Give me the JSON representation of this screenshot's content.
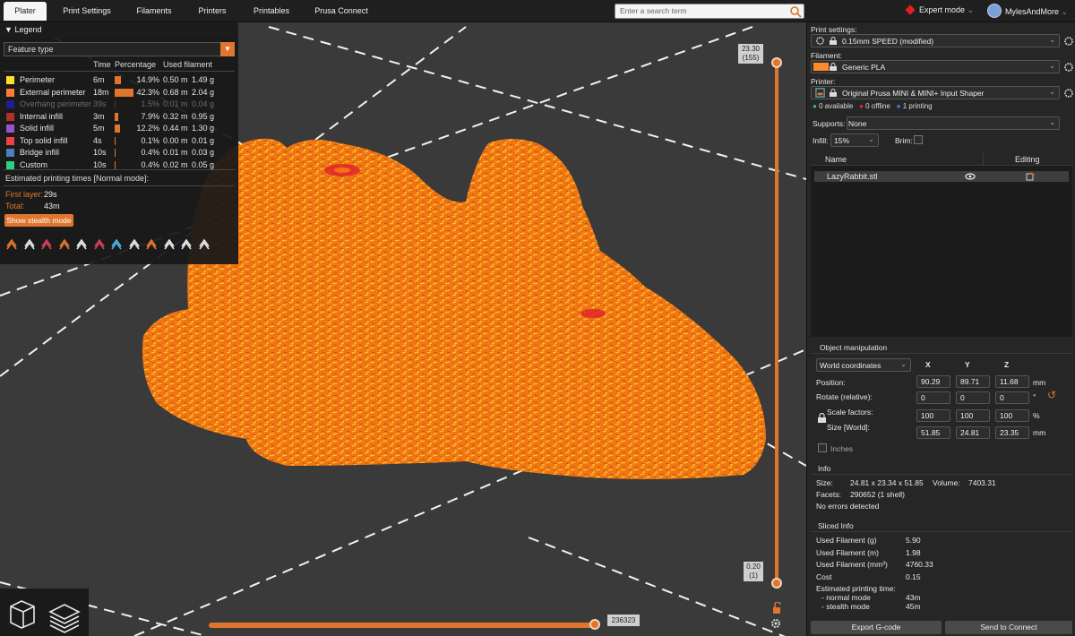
{
  "tabs": [
    "Plater",
    "Print Settings",
    "Filaments",
    "Printers",
    "Printables",
    "Prusa Connect"
  ],
  "search": {
    "placeholder": "Enter a search term"
  },
  "mode": "Expert mode",
  "user": "MylesAndMore",
  "legend": {
    "title": "Legend",
    "type": "Feature type",
    "col_time": "Time",
    "col_percentage": "Percentage",
    "col_used": "Used filament",
    "rows": [
      {
        "name": "Perimeter",
        "color": "#ffe12a",
        "time": "6m",
        "pct": "14.9%",
        "pct_value": 14.9,
        "m": "0.50 m",
        "g": "1.49 g",
        "dim": false
      },
      {
        "name": "External perimeter",
        "color": "#ff7d38",
        "time": "18m",
        "pct": "42.3%",
        "pct_value": 42.3,
        "m": "0.68 m",
        "g": "2.04 g",
        "dim": false
      },
      {
        "name": "Overhang perimeter",
        "color": "#1f1f8c",
        "time": "39s",
        "pct": "1.5%",
        "pct_value": 1.5,
        "m": "0.01 m",
        "g": "0.04 g",
        "dim": true
      },
      {
        "name": "Internal infill",
        "color": "#b03029",
        "time": "3m",
        "pct": "7.9%",
        "pct_value": 7.9,
        "m": "0.32 m",
        "g": "0.95 g",
        "dim": false
      },
      {
        "name": "Solid infill",
        "color": "#9654cc",
        "time": "5m",
        "pct": "12.2%",
        "pct_value": 12.2,
        "m": "0.44 m",
        "g": "1.30 g",
        "dim": false
      },
      {
        "name": "Top solid infill",
        "color": "#f0404a",
        "time": "4s",
        "pct": "0.1%",
        "pct_value": 0.1,
        "m": "0.00 m",
        "g": "0.01 g",
        "dim": false
      },
      {
        "name": "Bridge infill",
        "color": "#4d80ba",
        "time": "10s",
        "pct": "0.4%",
        "pct_value": 0.4,
        "m": "0.01 m",
        "g": "0.03 g",
        "dim": false
      },
      {
        "name": "Custom",
        "color": "#2bd181",
        "time": "10s",
        "pct": "0.4%",
        "pct_value": 0.4,
        "m": "0.02 m",
        "g": "0.05 g",
        "dim": false
      }
    ],
    "estimated_title": "Estimated printing times [Normal mode]:",
    "first_layer_label": "First layer:",
    "first_layer_value": "29s",
    "total_label": "Total:",
    "total_value": "43m",
    "stealth_button": "Show stealth mode",
    "icons": [
      "travel-icon",
      "wipe-icon",
      "retractions-icon",
      "deretractions-icon",
      "seams-icon",
      "tool-changes-icon",
      "color-changes-icon",
      "pause-prints-icon",
      "custom-gcodes-icon",
      "center-of-gravity-icon",
      "shells-icon",
      "tool-marker-icon"
    ]
  },
  "slider": {
    "top_height": "23.30",
    "top_layer": "(155)",
    "bottom_height": "0.20",
    "bottom_layer": "(1)",
    "horizontal_value": "236323"
  },
  "panel": {
    "print_settings_label": "Print settings:",
    "print_settings_value": "0.15mm SPEED (modified)",
    "filament_label": "Filament:",
    "filament_value": "Generic PLA",
    "filament_color": "#ff8a2a",
    "printer_label": "Printer:",
    "printer_value": "Original Prusa MINI & MINI+ Input Shaper",
    "status_available": "0 available",
    "status_offline": "0 offline",
    "status_printing": "1 printing",
    "supports_label": "Supports:",
    "supports_value": "None",
    "infill_label": "Infill:",
    "infill_value": "15%",
    "brim_label": "Brim:",
    "col_name": "Name",
    "col_editing": "Editing",
    "object_name": "LazyRabbit.stl",
    "object_manipulation_title": "Object manipulation",
    "coordinates": "World coordinates",
    "axis_x": "X",
    "axis_y": "Y",
    "axis_z": "Z",
    "position_label": "Position:",
    "position": [
      "90.29",
      "89.71",
      "11.68"
    ],
    "position_unit": "mm",
    "rotate_label": "Rotate (relative):",
    "rotate": [
      "0",
      "0",
      "0"
    ],
    "rotate_unit": "°",
    "scale_label": "Scale factors:",
    "scale": [
      "100",
      "100",
      "100"
    ],
    "scale_unit": "%",
    "size_label": "Size [World]:",
    "size": [
      "51.85",
      "24.81",
      "23.35"
    ],
    "size_unit": "mm",
    "inches_label": "Inches",
    "info_title": "Info",
    "info_size_label": "Size:",
    "info_size_value": "24.81 x 23.34 x 51.85",
    "info_volume_label": "Volume:",
    "info_volume_value": "7403.31",
    "info_facets_label": "Facets:",
    "info_facets_value": "290652 (1 shell)",
    "info_errors": "No errors detected",
    "sliced_title": "Sliced Info",
    "sliced_rows": [
      {
        "label": "Used Filament (g)",
        "value": "5.90"
      },
      {
        "label": "Used Filament (m)",
        "value": "1.98"
      },
      {
        "label": "Used Filament (mm³)",
        "value": "4760.33"
      },
      {
        "label": "Cost",
        "value": "0.15"
      }
    ],
    "est_time_label": "Estimated printing time:",
    "normal_mode_label": "- normal mode",
    "normal_mode_value": "43m",
    "stealth_mode_label": "- stealth mode",
    "stealth_mode_value": "45m",
    "export_button": "Export G-code",
    "send_button": "Send to Connect"
  }
}
